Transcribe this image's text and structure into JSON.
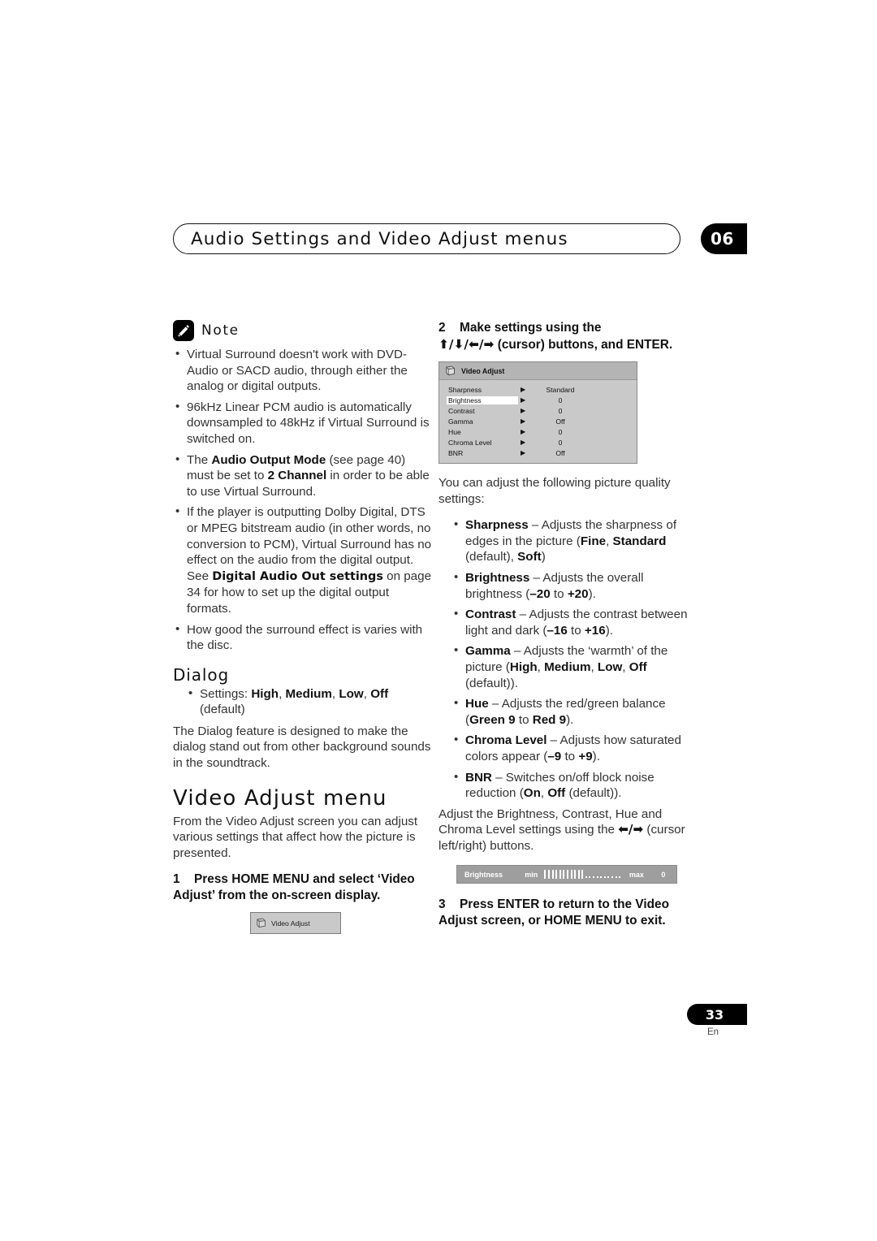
{
  "header": {
    "title": "Audio Settings and Video Adjust menus",
    "chapter": "06"
  },
  "left_column": {
    "note": {
      "label": "Note",
      "icon": "pencil-icon",
      "bullets": [
        "Virtual Surround doesn't work with DVD-Audio or SACD audio, through either the analog or digital outputs.",
        "96kHz Linear PCM audio is automatically downsampled to 48kHz if Virtual Surround is switched on.",
        "The Audio Output Mode (see page 40) must be set to 2 Channel in order to be able to use Virtual Surround.",
        "If the player is outputting Dolby Digital, DTS or MPEG bitstream audio (in other words, no conversion to PCM), Virtual Surround has no effect on the audio from the digital output. See Digital Audio Out settings on page 34 for how to set up the digital output formats.",
        "How good the surround effect is varies with the disc."
      ],
      "b3_pre": "The ",
      "b3_bold1": "Audio Output Mode",
      "b3_mid": " (see page 40) must be set to ",
      "b3_bold2": "2 Channel",
      "b3_post": " in order to be able to use Virtual Surround.",
      "b4_pre": "If the player is outputting Dolby Digital, DTS or MPEG bitstream audio (in other words, no conversion to PCM), Virtual Surround has no effect on the audio from the digital output. See ",
      "b4_bold": "Digital Audio Out settings",
      "b4_post": " on page 34 for how to set up the digital output formats."
    },
    "dialog": {
      "heading": "Dialog",
      "settings_prefix": "Settings: ",
      "settings_options": [
        "High",
        "Medium",
        "Low"
      ],
      "settings_last": "Off",
      "settings_default": "(default)",
      "paragraph": "The Dialog feature is designed to make the dialog stand out from other background sounds in the soundtrack."
    },
    "video_adjust": {
      "heading": "Video Adjust menu",
      "intro": "From the Video Adjust screen you can adjust various settings that affect how the picture is presented.",
      "step1_num": "1",
      "step1_text": "Press HOME MENU and select ‘Video Adjust’ from the on-screen display."
    },
    "osd_small": {
      "icon": "disc-icon",
      "label": "Video Adjust"
    }
  },
  "right_column": {
    "step2_num": "2",
    "step2_line1": "Make settings using the",
    "step2_cursors": "⬆/⬇/⬅/➡",
    "step2_line2_rest": " (cursor) buttons, and ENTER.",
    "osd_panel": {
      "icon": "disc-icon",
      "title": "Video Adjust",
      "arrow_glyph": "▶",
      "rows": [
        {
          "name": "Sharpness",
          "value": "Standard",
          "selected": false
        },
        {
          "name": "Brightness",
          "value": "0",
          "selected": true
        },
        {
          "name": "Contrast",
          "value": "0",
          "selected": false
        },
        {
          "name": "Gamma",
          "value": "Off",
          "selected": false
        },
        {
          "name": "Hue",
          "value": "0",
          "selected": false
        },
        {
          "name": "Chroma Level",
          "value": "0",
          "selected": false
        },
        {
          "name": "BNR",
          "value": "Off",
          "selected": false
        }
      ]
    },
    "intro": "You can adjust the following picture quality settings:",
    "settings": [
      {
        "name": "Sharpness",
        "desc_pre": " – Adjusts the sharpness of edges in the picture (",
        "opt1": "Fine",
        "sep1": ", ",
        "opt2": "Standard",
        "note2": " (default)",
        "sep2": ", ",
        "opt3": "Soft",
        "desc_post": ")"
      },
      {
        "name": "Brightness",
        "desc_pre": " – Adjusts the overall brightness (",
        "opt1": "–20",
        "sep1": " to ",
        "opt2": "+20",
        "desc_post": ")."
      },
      {
        "name": "Contrast",
        "desc_pre": " – Adjusts the contrast between light and dark (",
        "opt1": "–16",
        "sep1": " to ",
        "opt2": "+16",
        "desc_post": ")."
      },
      {
        "name": "Gamma",
        "desc_pre": " – Adjusts the ‘warmth’ of the picture (",
        "opt1": "High",
        "sep1": ", ",
        "opt2": "Medium",
        "sep2": ", ",
        "opt3": "Low",
        "sep3": ", ",
        "opt4": "Off",
        "note4": " (default)",
        "desc_post": ")."
      },
      {
        "name": "Hue",
        "desc_pre": " – Adjusts the red/green balance (",
        "opt1": "Green 9",
        "sep1": " to ",
        "opt2": "Red 9",
        "desc_post": ")."
      },
      {
        "name": "Chroma Level",
        "desc_pre": " – Adjusts how saturated colors appear (",
        "opt1": "–9",
        "sep1": " to ",
        "opt2": "+9",
        "desc_post": ")."
      },
      {
        "name": "BNR",
        "desc_pre": " – Switches on/off block noise reduction (",
        "opt1": "On",
        "sep1": ", ",
        "opt2": "Off",
        "note2": " (default)",
        "desc_post": ")."
      }
    ],
    "adjust_note_pre": "Adjust the Brightness, Contrast, Hue and Chroma Level settings using the ",
    "adjust_note_cursors": "⬅/➡",
    "adjust_note_post": " (cursor left/right) buttons.",
    "slider": {
      "name": "Brightness",
      "min_label": "min",
      "max_label": "max",
      "value": "0",
      "ticks_on": 11,
      "ticks_off": 10
    },
    "step3_num": "3",
    "step3_text": "Press ENTER to return to the Video Adjust screen, or HOME MENU to exit."
  },
  "footer": {
    "page_number": "33",
    "language": "En"
  },
  "colors": {
    "osd_body": "#c9c9c9",
    "osd_title": "#b4b4b4",
    "slider_bg": "#9e9e9e",
    "accent_black": "#000000",
    "text": "#333333"
  }
}
